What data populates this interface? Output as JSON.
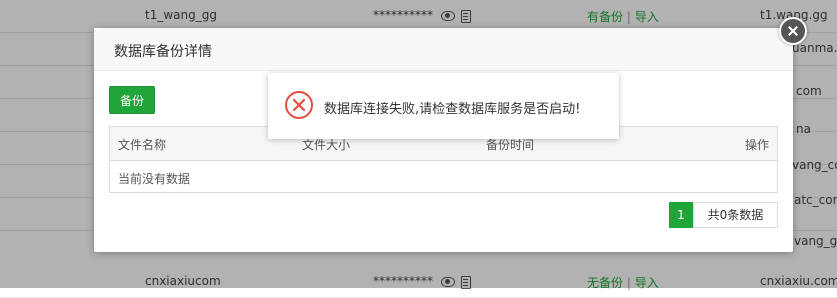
{
  "background": {
    "rows": [
      {
        "name": "t1_wang_gg",
        "password": "**********",
        "backup_status": "有备份",
        "import": "导入",
        "remark": "t1.wang.gg"
      },
      {
        "name": "",
        "password": "",
        "backup_status": "",
        "import": "",
        "remark": "uanma."
      },
      {
        "name": "",
        "password": "",
        "backup_status": "",
        "import": "",
        "remark": "com"
      },
      {
        "name": "",
        "password": "",
        "backup_status": "",
        "import": "",
        "remark": "na"
      },
      {
        "name": "",
        "password": "",
        "backup_status": "",
        "import": "",
        "remark": "vang_com"
      },
      {
        "name": "",
        "password": "",
        "backup_status": "",
        "import": "",
        "remark": "atc_com"
      },
      {
        "name": "",
        "password": "",
        "backup_status": "",
        "import": "",
        "remark": "vang_gg"
      },
      {
        "name": "cnxiaxiucom",
        "password": "**********",
        "backup_status": "无备份",
        "import": "导入",
        "remark": "cnxiaxiu.com"
      }
    ],
    "separator": "|"
  },
  "modal": {
    "title": "数据库备份详情",
    "backup_button": "备份",
    "table": {
      "headers": [
        "文件名称",
        "文件大小",
        "备份时间",
        "操作"
      ],
      "empty_text": "当前没有数据"
    },
    "pager": {
      "current_page": "1",
      "total_text": "共0条数据"
    }
  },
  "toast": {
    "icon": "error-circle-icon",
    "message": "数据库连接失败,请检查数据库服务是否启动!",
    "icon_color": "#e84c3d"
  },
  "colors": {
    "accent_green": "#20a53a",
    "error_red": "#e84c3d"
  }
}
